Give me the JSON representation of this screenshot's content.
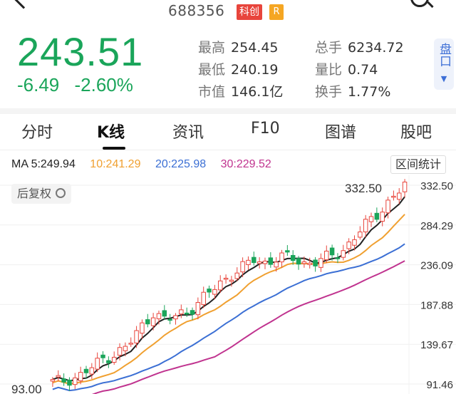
{
  "header": {
    "code": "688356",
    "board": "科创",
    "r_badge": "R"
  },
  "quote": {
    "price": "243.51",
    "change": "-6.49",
    "change_pct": "-2.60%",
    "color": "#1aa55a",
    "stats_left": [
      {
        "label": "最高",
        "value": "254.45"
      },
      {
        "label": "最低",
        "value": "240.19"
      },
      {
        "label": "市值",
        "value": "146.1亿"
      }
    ],
    "stats_right": [
      {
        "label": "总手",
        "value": "6234.72"
      },
      {
        "label": "量比",
        "value": "0.74"
      },
      {
        "label": "换手",
        "value": "1.77%"
      }
    ],
    "pankou_label": "盘口"
  },
  "tabs": [
    "分时",
    "K线",
    "资讯",
    "F10",
    "图谱",
    "股吧"
  ],
  "active_tab": "K线",
  "ma": {
    "ma5": {
      "label": "MA 5:249.94",
      "color": "#222222"
    },
    "ma10": {
      "label": "10:241.29",
      "color": "#f0a030"
    },
    "ma20": {
      "label": "20:225.98",
      "color": "#3b6fd4"
    },
    "ma30": {
      "label": "30:229.52",
      "color": "#c0338f"
    }
  },
  "range_stats_label": "区间统计",
  "adjust_label": "后复权",
  "chart_data": {
    "type": "candlestick",
    "y_ticks": [
      "332.50",
      "284.29",
      "236.09",
      "187.88",
      "139.67",
      "91.46"
    ],
    "max_label": "332.50",
    "min_label": "93.00",
    "up_color": "#e8453c",
    "down_color": "#1aa55a"
  }
}
